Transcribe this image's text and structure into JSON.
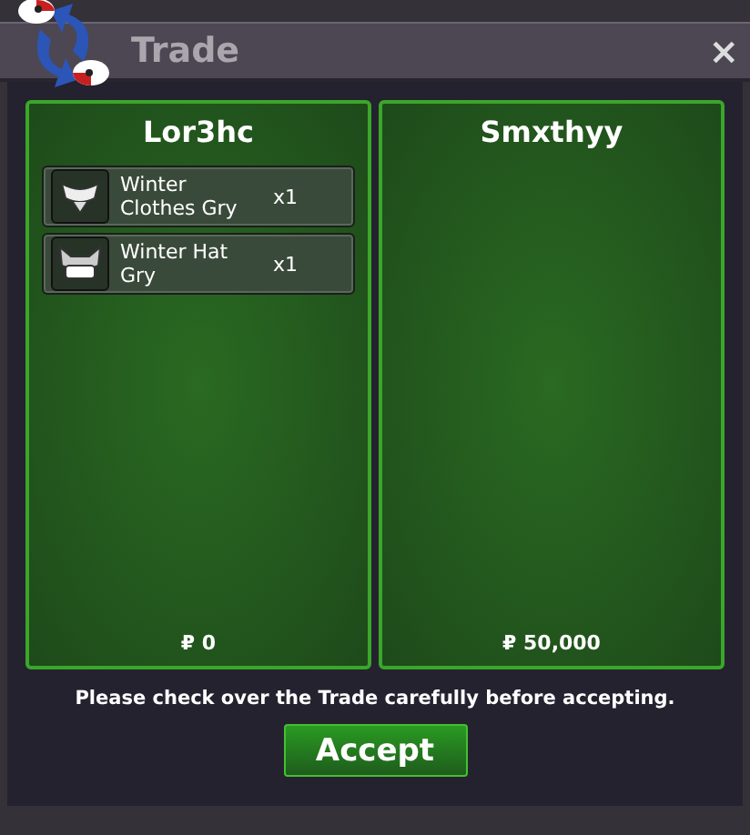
{
  "window": {
    "title": "Trade",
    "close": "×"
  },
  "panels": [
    {
      "player": "Lor3hc",
      "items": [
        {
          "name": "Winter Clothes Gry",
          "quantity": "x1",
          "kind": "clothes"
        },
        {
          "name": "Winter Hat Gry",
          "quantity": "x1",
          "kind": "hat"
        }
      ],
      "money": "₽ 0"
    },
    {
      "player": "Smxthyy",
      "money": "₽ 50,000"
    }
  ],
  "notice": "Please check over the Trade carefully before accepting.",
  "accept_button": "Accept"
}
